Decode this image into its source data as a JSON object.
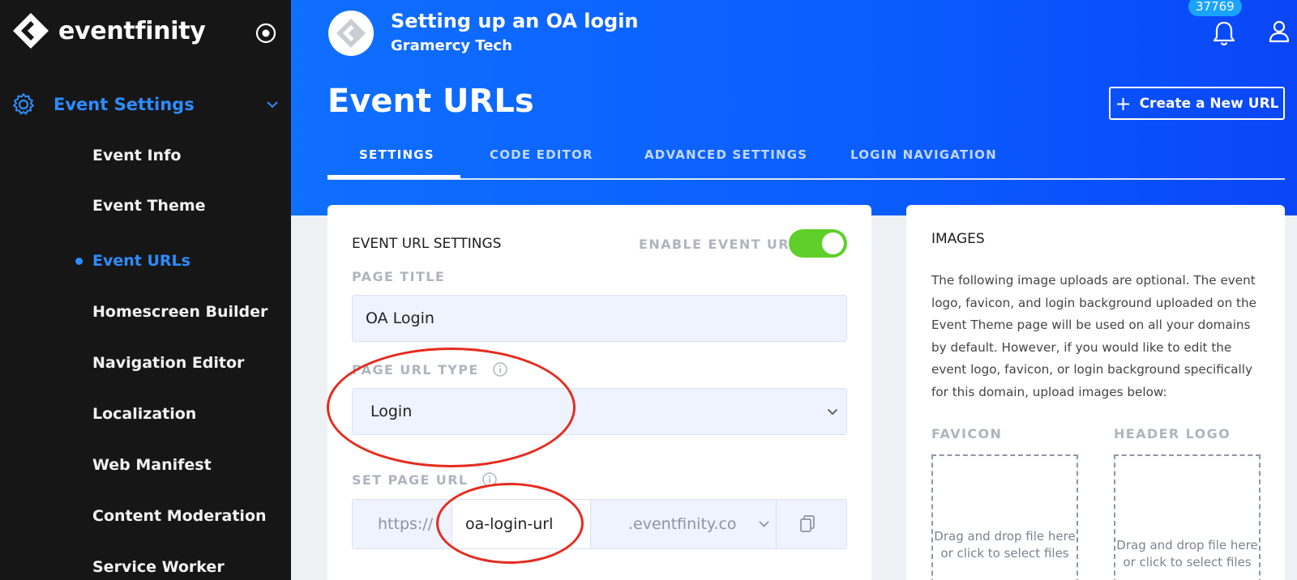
{
  "brand": {
    "name": "eventfinity"
  },
  "sidebar": {
    "section": {
      "label": "Event Settings"
    },
    "items": [
      {
        "label": "Event Info"
      },
      {
        "label": "Event Theme"
      },
      {
        "label": "Event URLs",
        "active": true
      },
      {
        "label": "Homescreen Builder"
      },
      {
        "label": "Navigation Editor"
      },
      {
        "label": "Localization"
      },
      {
        "label": "Web Manifest"
      },
      {
        "label": "Content Moderation"
      },
      {
        "label": "Service Worker"
      }
    ]
  },
  "header": {
    "event_name": "Setting up an OA login",
    "org_name": "Gramercy Tech",
    "notification_count": "37769",
    "page_title": "Event URLs",
    "create_button": "Create a New URL",
    "tabs": [
      {
        "label": "SETTINGS",
        "active": true
      },
      {
        "label": "CODE EDITOR"
      },
      {
        "label": "ADVANCED SETTINGS"
      },
      {
        "label": "LOGIN NAVIGATION"
      }
    ]
  },
  "url_settings": {
    "heading": "EVENT URL SETTINGS",
    "enable_label": "ENABLE EVENT URL",
    "enabled": true,
    "page_title_label": "PAGE TITLE",
    "page_title_value": "OA Login",
    "url_type_label": "PAGE URL TYPE",
    "url_type_value": "Login",
    "set_url_label": "SET PAGE URL",
    "protocol": "https://",
    "slug": "oa-login-url",
    "domain": ".eventfinity.co"
  },
  "images": {
    "heading": "IMAGES",
    "description": "The following image uploads are optional. The event logo, favicon, and login background uploaded on the Event Theme page will be used on all your domains by default. However, if you would like to edit the event logo, favicon, or login background specifically for this domain, upload images below:",
    "favicon_label": "FAVICON",
    "header_logo_label": "HEADER LOGO",
    "dropzone_line1": "Drag and drop file here",
    "dropzone_line2": "or click to select files"
  },
  "colors": {
    "accent": "#2d8cff",
    "header_blue": "#0a5cff",
    "toggle_on": "#5fcf2a",
    "annotation_red": "#e52b1f"
  }
}
